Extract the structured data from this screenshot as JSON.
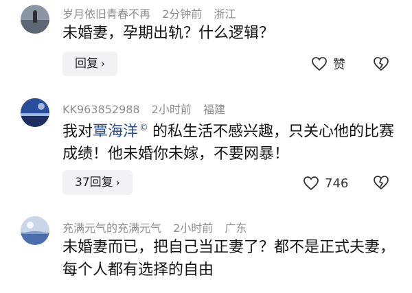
{
  "comments": [
    {
      "username": "岁月依旧青春不再",
      "time": "2分钟前",
      "location": "浙江",
      "text": "未婚妻，孕期出轨？什么逻辑？",
      "reply_label": "回复",
      "like_label": "赞"
    },
    {
      "username": "KK963852988",
      "time": "2小时前",
      "location": "福建",
      "text_before": "我对",
      "mention": "覃海洋",
      "mention_mark": "©",
      "text_after": "的私生活不感兴趣，只关心他的比赛成绩！他未婚你未嫁，不要网暴！",
      "reply_label": "37回复",
      "like_count": "746"
    },
    {
      "username": "充满元气的充满元气",
      "time": "2小时前",
      "location": "广东",
      "text": "未婚妻而已，把自己当正妻了？都不是正式夫妻，每个人都有选择的自由"
    }
  ],
  "icons": {
    "like": "heart-outline-icon",
    "dislike": "broken-heart-icon",
    "chevron": "chevron-right-icon"
  },
  "colors": {
    "mention": "#2b4e8c",
    "meta": "#8c8c8c",
    "reply_bg": "#f2f2f4"
  }
}
